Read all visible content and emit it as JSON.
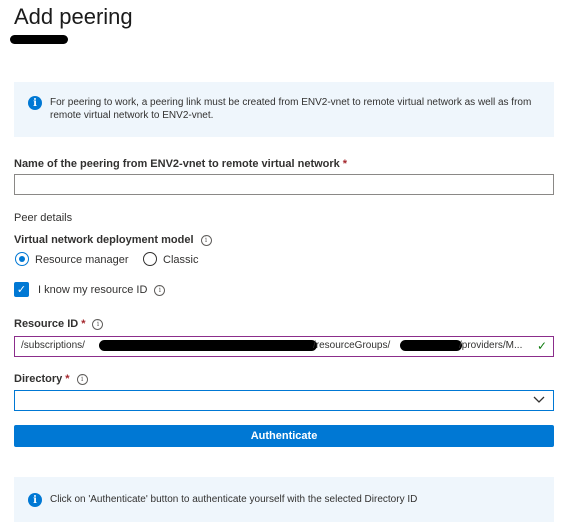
{
  "page": {
    "title": "Add peering"
  },
  "info_top": {
    "icon": "info-icon",
    "text": "For peering to work, a peering link must be created from ENV2-vnet to remote virtual network as well as from remote virtual network to ENV2-vnet."
  },
  "peering_name": {
    "label": "Name of the peering from ENV2-vnet to remote virtual network",
    "required_mark": "*",
    "value": ""
  },
  "peer_details": {
    "heading": "Peer details"
  },
  "deployment_model": {
    "label": "Virtual network deployment model",
    "options": [
      {
        "label": "Resource manager",
        "selected": true
      },
      {
        "label": "Classic",
        "selected": false
      }
    ]
  },
  "know_id": {
    "label": "I know my resource ID",
    "checked": true
  },
  "resource_id": {
    "label": "Resource ID",
    "required_mark": "*",
    "value_prefix": "/subscriptions/",
    "value_mid": "/resourceGroups/",
    "value_suffix": "/providers/M...",
    "valid_icon": "checkmark-icon"
  },
  "directory": {
    "label": "Directory",
    "required_mark": "*",
    "value": ""
  },
  "authenticate": {
    "label": "Authenticate"
  },
  "info_bottom": {
    "icon": "info-icon",
    "text": "Click on 'Authenticate' button to authenticate yourself with the selected Directory ID"
  },
  "colors": {
    "accent": "#0078d4",
    "info_bg": "#eff6fc",
    "required": "#a4262c",
    "valid": "#107c10"
  }
}
